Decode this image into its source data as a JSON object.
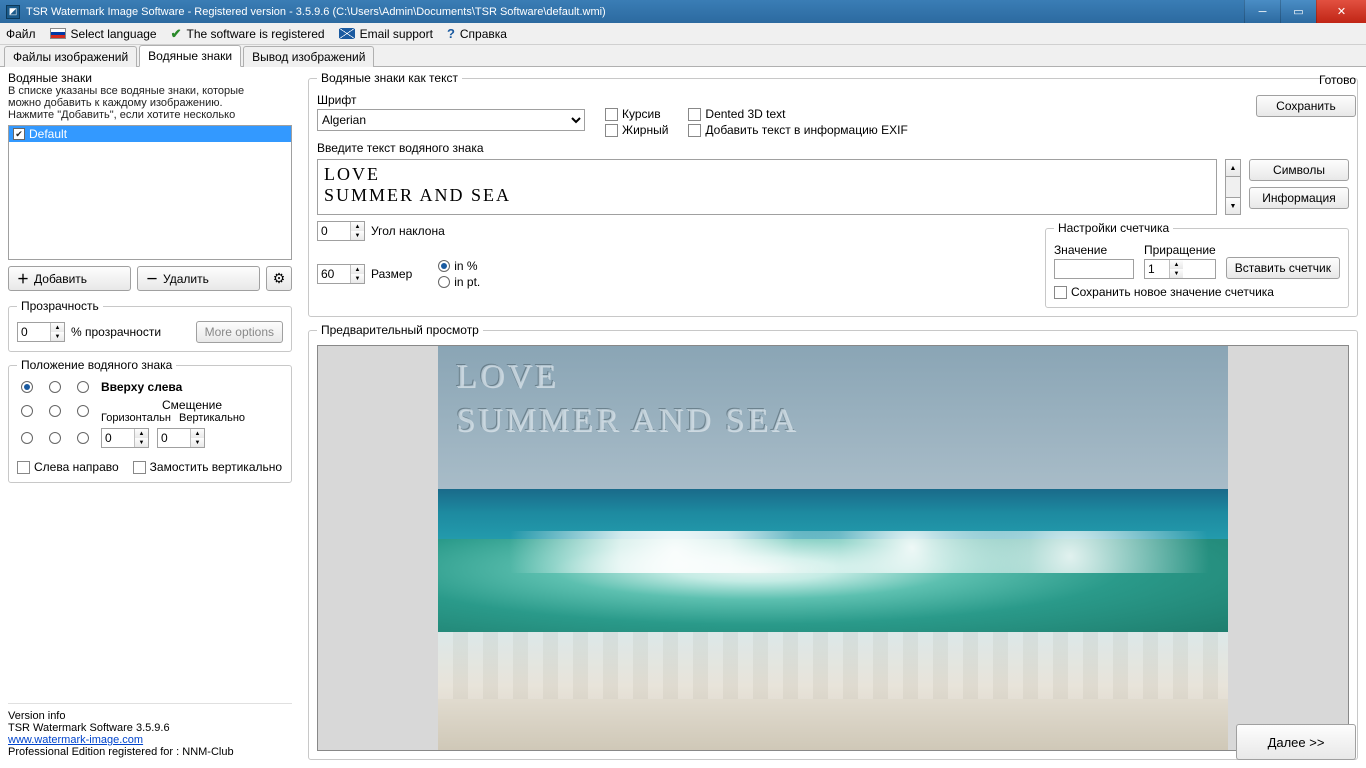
{
  "window": {
    "title": "TSR Watermark Image Software - Registered version - 3.5.9.6 (C:\\Users\\Admin\\Documents\\TSR Software\\default.wmi)"
  },
  "menu": {
    "file": "Файл",
    "language": "Select language",
    "registered": "The software is registered",
    "email": "Email support",
    "help": "Справка"
  },
  "tabs": {
    "files": "Файлы изображений",
    "watermarks": "Водяные знаки",
    "output": "Вывод изображений"
  },
  "wm_group": {
    "title": "Водяные знаки",
    "desc1": "В списке указаны все водяные знаки, которые",
    "desc2": "можно добавить к каждому изображению.",
    "desc3": "Нажмите \"Добавить\", если хотите несколько",
    "item1": "Default",
    "add": "Добавить",
    "delete": "Удалить"
  },
  "text_group": {
    "title": "Водяные знаки как текст",
    "font_label": "Шрифт",
    "font": "Algerian",
    "italic": "Курсив",
    "bold": "Жирный",
    "dented": "Dented 3D text",
    "exif": "Добавить текст в информацию EXIF",
    "enter_label": "Введите текст водяного знака",
    "text_line1": "LOVE",
    "text_line2": "SUMMER AND SEA",
    "symbols": "Символы",
    "info": "Информация",
    "angle_label": "Угол наклона",
    "angle_val": "0",
    "size_label": "Размер",
    "size_val": "60",
    "unit_pct": "in %",
    "unit_pt": "in pt."
  },
  "counter": {
    "title": "Настройки счетчика",
    "value_label": "Значение",
    "value": "",
    "incr_label": "Приращение",
    "incr": "1",
    "insert": "Вставить счетчик",
    "save": "Сохранить новое значение счетчика"
  },
  "transparency": {
    "title": "Прозрачность",
    "val": "0",
    "label": "% прозрачности",
    "more": "More options"
  },
  "position": {
    "title": "Положение водяного знака",
    "top_left": "Вверху слева",
    "offset": "Смещение",
    "horiz": "Горизонтальн",
    "vert": "Вертикально",
    "hval": "0",
    "vval": "0",
    "ltr": "Слева направо",
    "tile": "Замостить вертикально"
  },
  "version": {
    "title": "Version info",
    "line1": "TSR Watermark Software 3.5.9.6",
    "url": "www.watermark-image.com",
    "line2": "Professional Edition registered for : NNM-Club"
  },
  "preview": {
    "title": "Предварительный просмотр",
    "ready": "Готово",
    "save": "Сохранить",
    "next": "Далее >>"
  }
}
